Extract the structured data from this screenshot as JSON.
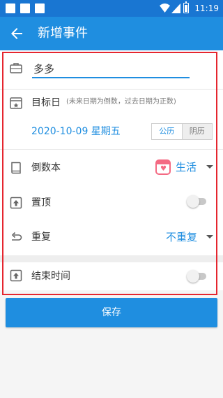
{
  "status_bar": {
    "time": "11:19"
  },
  "app_bar": {
    "title": "新增事件",
    "back_icon": "arrow-left-icon"
  },
  "form": {
    "name_input": {
      "value": "多多",
      "icon": "briefcase-icon"
    },
    "target_date": {
      "label": "目标日",
      "hint": "(未来日期为倒数，过去日期为正数)",
      "date": "2020-10-09 星期五",
      "icon": "calendar-icon",
      "calendar_types": [
        "公历",
        "阴历"
      ],
      "selected_calendar": "公历"
    },
    "countdown_book": {
      "label": "倒数本",
      "value": "生活",
      "icon": "book-icon",
      "tag_icon": "heart-calendar-icon",
      "tag_color": "#f46a83"
    },
    "pin_top": {
      "label": "置顶",
      "enabled": false,
      "icon": "pin-top-icon"
    },
    "repeat": {
      "label": "重复",
      "value": "不重复",
      "icon": "repeat-icon"
    },
    "end_time": {
      "label": "结束时间",
      "enabled": false,
      "icon": "end-time-icon"
    }
  },
  "save_button": {
    "label": "保存"
  },
  "colors": {
    "primary": "#1f8ee0",
    "status_bar": "#1976d2",
    "highlight": "#e5262f"
  }
}
